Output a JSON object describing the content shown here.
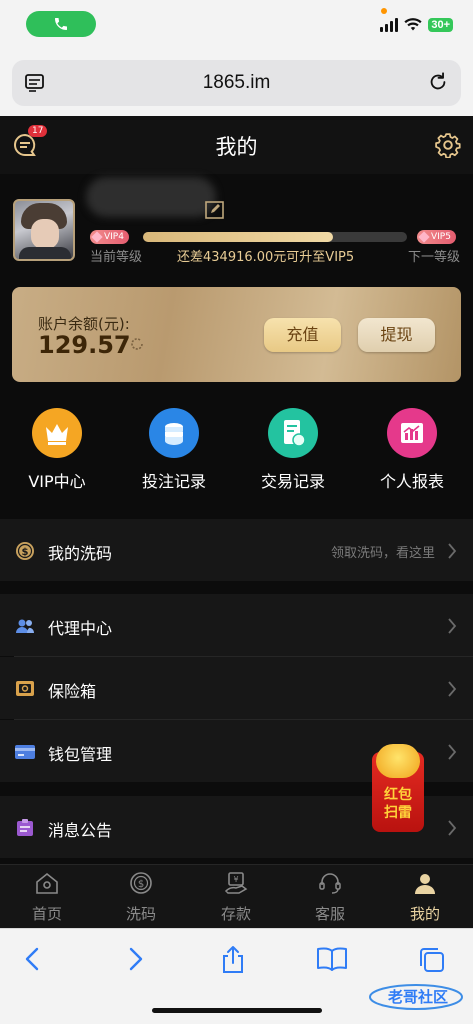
{
  "browser": {
    "url": "1865.im"
  },
  "header": {
    "title": "我的",
    "badge": "17"
  },
  "profile": {
    "vip_current_tag": "VIP4",
    "vip_next_tag": "VIP5",
    "current_level_label": "当前等级",
    "next_level_label": "下一等级",
    "upgrade_message": "还差434916.00元可升至VIP5",
    "progress_fraction": 0.72
  },
  "balance": {
    "label": "账户余额(元):",
    "value": "129.57",
    "deposit_label": "充值",
    "withdraw_label": "提现"
  },
  "quick_actions": [
    {
      "label": "VIP中心",
      "icon": "crown-icon",
      "color": "#f5a623"
    },
    {
      "label": "投注记录",
      "icon": "coins-icon",
      "color": "#2a86e6"
    },
    {
      "label": "交易记录",
      "icon": "receipt-icon",
      "color": "#23c3a0"
    },
    {
      "label": "个人报表",
      "icon": "chart-icon",
      "color": "#e5398b"
    }
  ],
  "menu": {
    "rebate": {
      "label": "我的洗码",
      "hint": "领取洗码，看这里"
    },
    "agent": {
      "label": "代理中心"
    },
    "safe": {
      "label": "保险箱"
    },
    "wallet": {
      "label": "钱包管理"
    },
    "notice": {
      "label": "消息公告"
    }
  },
  "red_packet": {
    "line1": "红包",
    "line2": "扫雷"
  },
  "tabs": [
    {
      "label": "首页"
    },
    {
      "label": "洗码"
    },
    {
      "label": "存款"
    },
    {
      "label": "客服"
    },
    {
      "label": "我的"
    }
  ],
  "watermark": "老哥社区"
}
